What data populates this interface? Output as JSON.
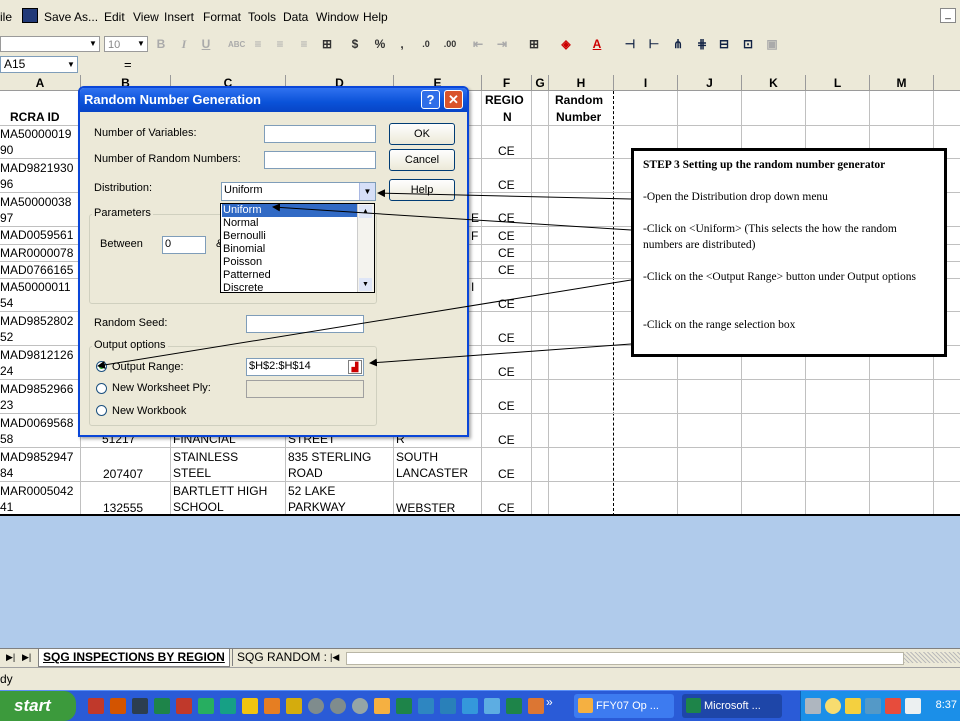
{
  "menubar": {
    "items": [
      "ile",
      "Save As...",
      "Edit",
      "View",
      "Insert",
      "Format",
      "Tools",
      "Data",
      "Window",
      "Help"
    ]
  },
  "toolbar": {
    "font_size": "10",
    "font_size_placeholder": "",
    "bold": "B",
    "italic": "I",
    "underline": "U",
    "currency": "$",
    "percent": "%",
    "comma": ",",
    "inc_decimal": ".0",
    "dec_decimal": ".00"
  },
  "formula_bar": {
    "name_box": "A15",
    "equals": "="
  },
  "sheet": {
    "columns": [
      {
        "label": "A"
      },
      {
        "label": "B"
      },
      {
        "label": "C"
      },
      {
        "label": "D"
      },
      {
        "label": "E"
      },
      {
        "label": "F"
      },
      {
        "label": "G"
      },
      {
        "label": "H"
      },
      {
        "label": "I"
      },
      {
        "label": "J"
      },
      {
        "label": "K"
      },
      {
        "label": "L"
      },
      {
        "label": "M"
      }
    ],
    "header_a": "RCRA ID",
    "header_f": [
      "REGIO",
      "N"
    ],
    "header_h": [
      "Random",
      "Number"
    ],
    "col_a": [
      [
        "MA50000019",
        "90"
      ],
      [
        "MAD9821930",
        "96"
      ],
      [
        "MA50000038",
        "97"
      ],
      [
        "MAD0059561"
      ],
      [
        "MAR0000078"
      ],
      [
        "MAD0766165"
      ],
      [
        "MA50000011",
        "54"
      ],
      [
        "MAD9852802",
        "52"
      ],
      [
        "MAD9812126",
        "24"
      ],
      [
        "MAD9852966",
        "23"
      ],
      [
        "MAD0069568",
        "58"
      ],
      [
        "MAD9852947",
        "84"
      ],
      [
        "MAR0005042",
        "41"
      ]
    ],
    "col_f": [
      "CE",
      "CE",
      "CE",
      "CE",
      "CE",
      "CE",
      "CE",
      "CE",
      "CE",
      "CE",
      "CE",
      "CE",
      "CE"
    ],
    "row12": {
      "b": "207407",
      "c": [
        "STAINLESS",
        "STEEL"
      ],
      "d": [
        "835 STERLING",
        "ROAD"
      ],
      "e": [
        "SOUTH",
        "LANCASTER"
      ]
    },
    "row13": {
      "b": "132555",
      "c": [
        "BARTLETT HIGH",
        "SCHOOL"
      ],
      "d": [
        "52 LAKE",
        "PARKWAY"
      ],
      "e": [
        "WEBSTER"
      ]
    },
    "row11_partial": {
      "b": "51217",
      "c": "FINANCIAL",
      "d": "STREET",
      "e": "R"
    },
    "e_fragments": [
      "E",
      "F"
    ],
    "e_fragment_row7": "I"
  },
  "dialog": {
    "title": "Random Number Generation",
    "help_icon": "?",
    "close_icon": "✕",
    "num_variables_label": "Number of Variables:",
    "num_random_label": "Number of Random Numbers:",
    "distribution_label": "Distribution:",
    "distribution_value": "Uniform",
    "parameters_label": "Parameters",
    "between_label": "Between",
    "between_value": "0",
    "and_fragment": "&",
    "random_seed_label": "Random Seed:",
    "output_options_label": "Output options",
    "output_range_label": "Output Range:",
    "output_range_value": "$H$2:$H$14",
    "new_worksheet_label": "New Worksheet Ply:",
    "new_workbook_label": "New Workbook",
    "ok_label": "OK",
    "cancel_label": "Cancel",
    "help_label": "Help",
    "distribution_options": [
      "Uniform",
      "Normal",
      "Bernoulli",
      "Binomial",
      "Poisson",
      "Patterned",
      "Discrete"
    ]
  },
  "instructions": {
    "title": "STEP 3  Setting up the random number generator",
    "steps": [
      "-Open the Distribution  drop down menu",
      "-Click  on <Uniform> (This  selects the how the random numbers are distributed)",
      "-Click  on the <Output Range> button under  Output options",
      "-Click  on the range selection box"
    ]
  },
  "tabs": {
    "active": "SQG INSPECTIONS BY REGION",
    "other": "SQG RANDOM :"
  },
  "status": {
    "text": "dy"
  },
  "taskbar": {
    "start": "start",
    "task1": "FFY07 Op ...",
    "task2": "Microsoft ...",
    "clock": "8:37"
  }
}
